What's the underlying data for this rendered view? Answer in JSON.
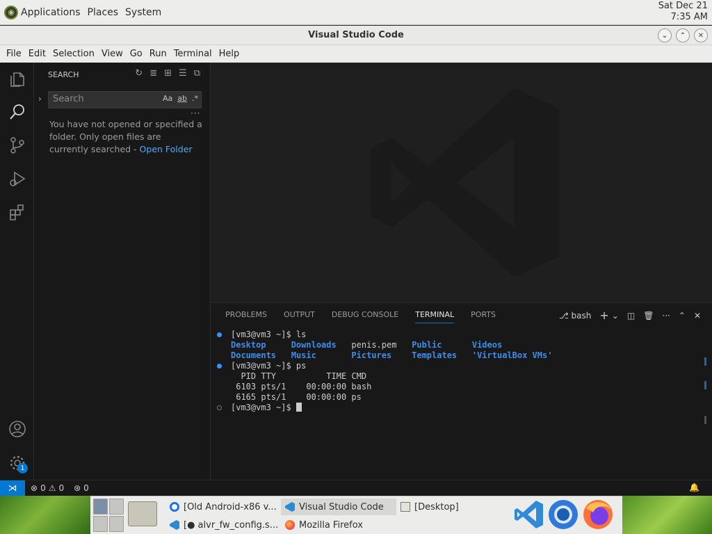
{
  "top_panel": {
    "menus": [
      "Applications",
      "Places",
      "System"
    ],
    "date": "Sat Dec 21",
    "time": "7:35 AM"
  },
  "window": {
    "title": "Visual Studio Code",
    "menubar": [
      "File",
      "Edit",
      "Selection",
      "View",
      "Go",
      "Run",
      "Terminal",
      "Help"
    ]
  },
  "sidebar": {
    "title": "SEARCH",
    "search_placeholder": "Search",
    "opt_case": "Aa",
    "opt_word": "ab",
    "opt_regex": ".*",
    "message": "You have not opened or specified a folder. Only open files are currently searched - ",
    "open_folder_link": "Open Folder"
  },
  "activity_badge": "1",
  "panel": {
    "tabs": [
      "PROBLEMS",
      "OUTPUT",
      "DEBUG CONSOLE",
      "TERMINAL",
      "PORTS"
    ],
    "active_tab": "TERMINAL",
    "shell_name": "bash"
  },
  "terminal": {
    "prompt": "[vm3@vm3 ~]$ ",
    "cmd1": "ls",
    "ls_row1": [
      "Desktop",
      "Downloads",
      "penis.pem",
      "Public",
      "Videos"
    ],
    "ls_row2": [
      "Documents",
      "Music",
      "Pictures",
      "Templates",
      "'VirtualBox VMs'"
    ],
    "cmd2": "ps",
    "ps_header": "  PID TTY          TIME CMD",
    "ps_row1": " 6103 pts/1    00:00:00 bash",
    "ps_row2": " 6165 pts/1    00:00:00 ps"
  },
  "statusbar": {
    "errors": "0",
    "warnings": "0",
    "ports": "0"
  },
  "taskbar": {
    "tasks": [
      "[Old Android-x86 v...",
      "Visual Studio Code",
      "[Desktop]",
      "[● alvr_fw_config.s...",
      "Mozilla Firefox"
    ]
  },
  "colors": {
    "accent": "#0078d4",
    "link": "#4daafc",
    "terminal_dir": "#3b8eea"
  }
}
